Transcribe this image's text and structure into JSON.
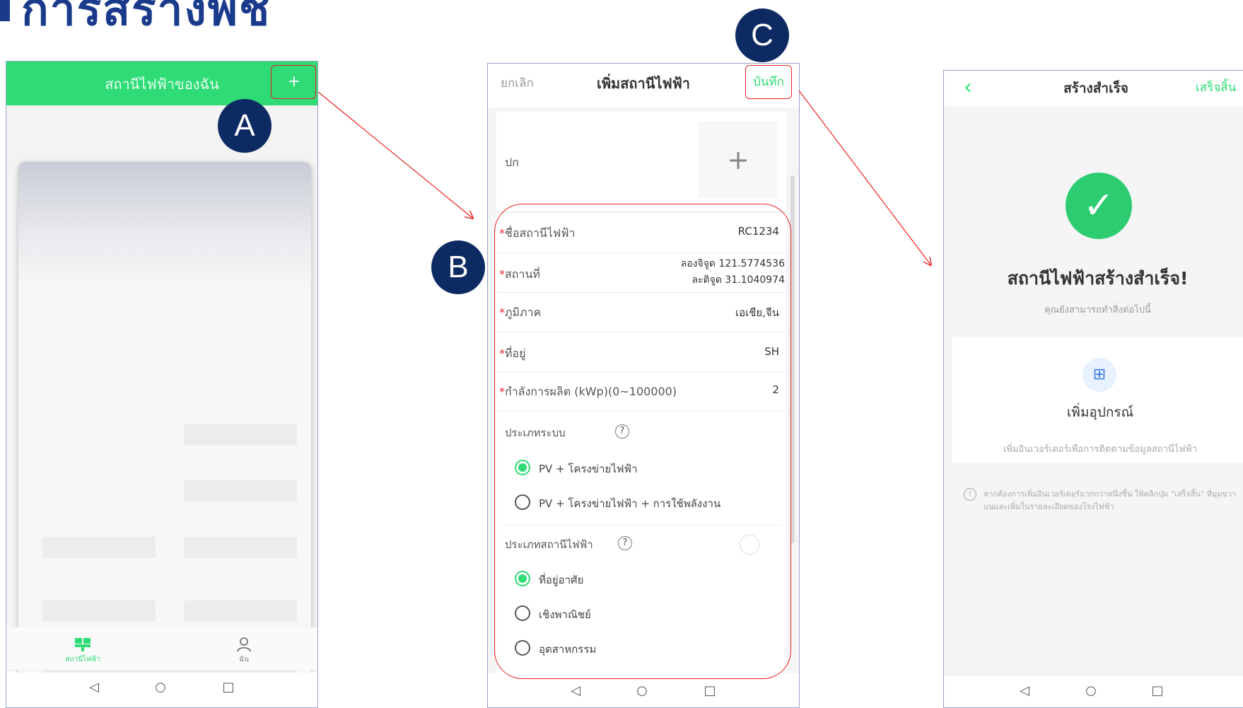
{
  "page_title": "การสร้างพืช",
  "screen_a": {
    "header_title": "สถานีไฟฟ้าของฉัน",
    "add_label": "+",
    "tabs": [
      {
        "label": "สถานีไฟฟ้า",
        "icon": "solar-panel-icon",
        "active": true
      },
      {
        "label": "ฉัน",
        "icon": "user-icon",
        "active": false
      }
    ]
  },
  "screen_b": {
    "cancel": "ยกเลิก",
    "title": "เพิ่มสถานีไฟฟ้า",
    "save": "บันทึก",
    "cover_label": "ปก",
    "upload_plus": "+",
    "fields": {
      "name_label": "ชื่อสถานีไฟฟ้า",
      "name_value": "RC1234",
      "location_label": "สถานที่",
      "longitude": "ลองจิจูด 121.5774536",
      "latitude": "ละติจูด 31.1040974",
      "region_label": "ภูมิภาค",
      "region_value": "เอเชีย,จีน",
      "address_label": "ที่อยู่",
      "address_value": "SH",
      "capacity_label": "กำลังการผลิต (kWp)(0~100000)",
      "capacity_value": "2"
    },
    "system_type_label": "ประเภทระบบ",
    "system_types": [
      "PV + โครงข่ายไฟฟ้า",
      "PV + โครงข่ายไฟฟ้า + การใช้พลังงาน"
    ],
    "system_type_selected": 0,
    "station_type_label": "ประเภทสถานีไฟฟ้า",
    "station_types": [
      "ที่อยู่อาศัย",
      "เชิงพาณิชย์",
      "อุตสาหกรรม"
    ],
    "station_type_selected": 0,
    "required_mark": "*",
    "help": "?"
  },
  "screen_c": {
    "title": "สร้างสำเร็จ",
    "done": "เสร็จสิ้น",
    "success": "สถานีไฟฟ้าสร้างสำเร็จ!",
    "sub": "คุณยังสามารถทำสิ่งต่อไปนี้",
    "add_device": "เพิ่มอุปกรณ์",
    "add_device_desc": "เพิ่มอินเวอร์เตอร์เพื่อการติดตามข้อมูลสถานีไฟฟ้า",
    "note": "หากต้องการเพิ่มอินเวอร์เตอร์มากกว่าหนึ่งชิ้น ให้คลิกปุ่ม \"เสร็จสิ้น\" ที่มุมขวาบนและเพิ่มในรายละเอียดของโรงไฟฟ้า",
    "note_icon": "!"
  },
  "badges": {
    "a": "A",
    "b": "B",
    "c": "C"
  },
  "nav_icons": {
    "back": "◁",
    "home": "○",
    "recent": "□"
  },
  "colors": {
    "accent": "#2edb75",
    "badge": "#0d2a63",
    "highlight": "#e22222",
    "title": "#1a3a8c"
  }
}
